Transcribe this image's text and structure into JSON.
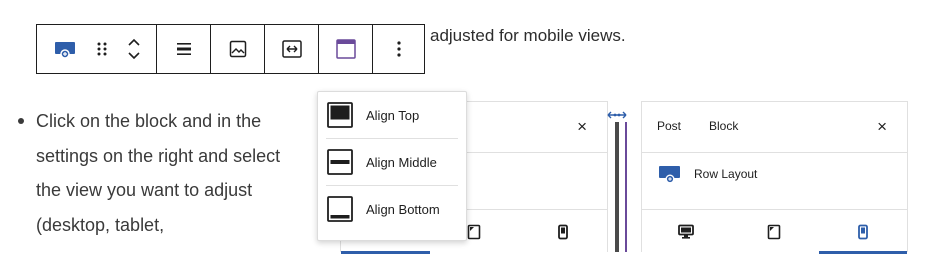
{
  "toolbar": {
    "items": [
      {
        "name": "row-block-icon"
      },
      {
        "name": "drag-handle-icon"
      },
      {
        "name": "move-up-icon"
      },
      {
        "name": "move-down-icon"
      },
      {
        "name": "align-middle-icon"
      },
      {
        "name": "image-icon"
      },
      {
        "name": "stretch-icon"
      },
      {
        "name": "align-top-icon"
      },
      {
        "name": "more-options-icon"
      }
    ]
  },
  "intro_text": "adjusted for mobile views.",
  "list": {
    "items": [
      "Click on the block and in the settings on the right and select the view you want to adjust (desktop, tablet,"
    ]
  },
  "align_menu": {
    "items": [
      {
        "label": "Align Top"
      },
      {
        "label": "Align Middle"
      },
      {
        "label": "Align Bottom"
      }
    ]
  },
  "panel_b": {
    "tabs": [
      "Post",
      "Block"
    ],
    "close": "×",
    "block_title": "Row Layout"
  },
  "panel_a": {
    "close": "×"
  },
  "colors": {
    "accent_blue": "#2e5eaa",
    "toolbar_border": "#1e1e1e",
    "divider_purple": "#6a4a9a"
  }
}
